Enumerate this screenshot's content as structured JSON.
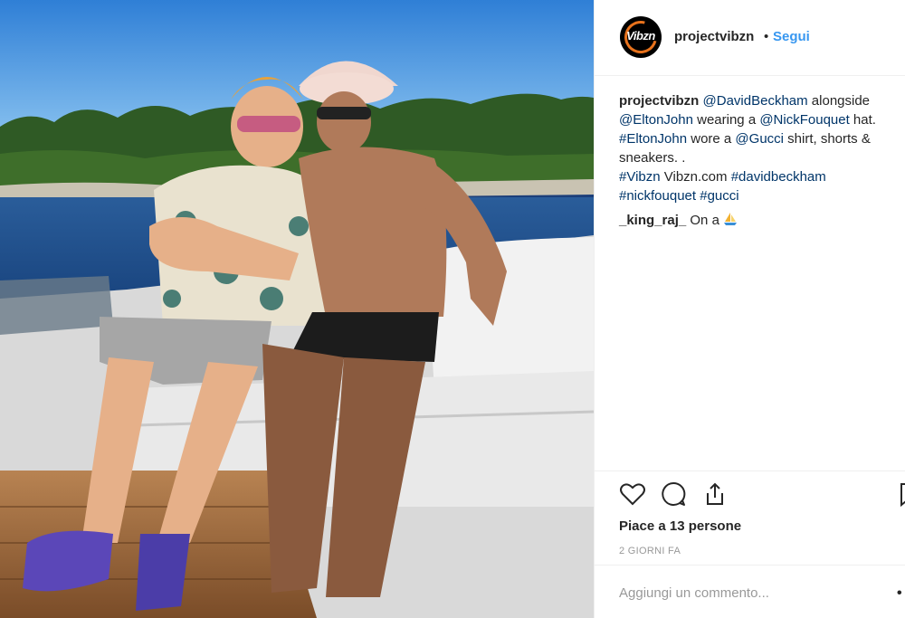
{
  "post": {
    "username": "projectvibzn",
    "separator": "•",
    "follow_label": "Segui",
    "avatar_logo_text": "Vibzn"
  },
  "caption": {
    "author": "projectvibzn",
    "parts": [
      {
        "type": "mention",
        "text": "@DavidBeckham"
      },
      {
        "type": "text",
        "text": " alongside "
      },
      {
        "type": "mention",
        "text": "@EltonJohn"
      },
      {
        "type": "text",
        "text": " wearing a "
      },
      {
        "type": "mention",
        "text": "@NickFouquet"
      },
      {
        "type": "text",
        "text": " hat. "
      },
      {
        "type": "mention",
        "text": "#EltonJohn"
      },
      {
        "type": "text",
        "text": " wore a "
      },
      {
        "type": "mention",
        "text": "@Gucci"
      },
      {
        "type": "text",
        "text": " shirt, shorts & sneakers. ."
      },
      {
        "type": "break"
      },
      {
        "type": "mention",
        "text": "#Vibzn"
      },
      {
        "type": "text",
        "text": " Vibzn.com "
      },
      {
        "type": "mention",
        "text": "#davidbeckham"
      },
      {
        "type": "break"
      },
      {
        "type": "mention",
        "text": "#nickfouquet"
      },
      {
        "type": "text",
        "text": " "
      },
      {
        "type": "mention",
        "text": "#gucci"
      }
    ]
  },
  "comment": {
    "author": "_king_raj_",
    "text": "On a",
    "emoji_icon": "sailboat-emoji"
  },
  "actions": {
    "icons": [
      "heart-icon",
      "comment-icon",
      "share-icon",
      "bookmark-icon"
    ]
  },
  "likes_text": "Piace a 13 persone",
  "date_text": "2 GIORNI FA",
  "add_comment": {
    "placeholder": "Aggiungi un commento...",
    "more_label": "•"
  },
  "colors": {
    "link": "#003569",
    "follow": "#3897f0",
    "muted": "#999999",
    "border": "#efefef"
  }
}
